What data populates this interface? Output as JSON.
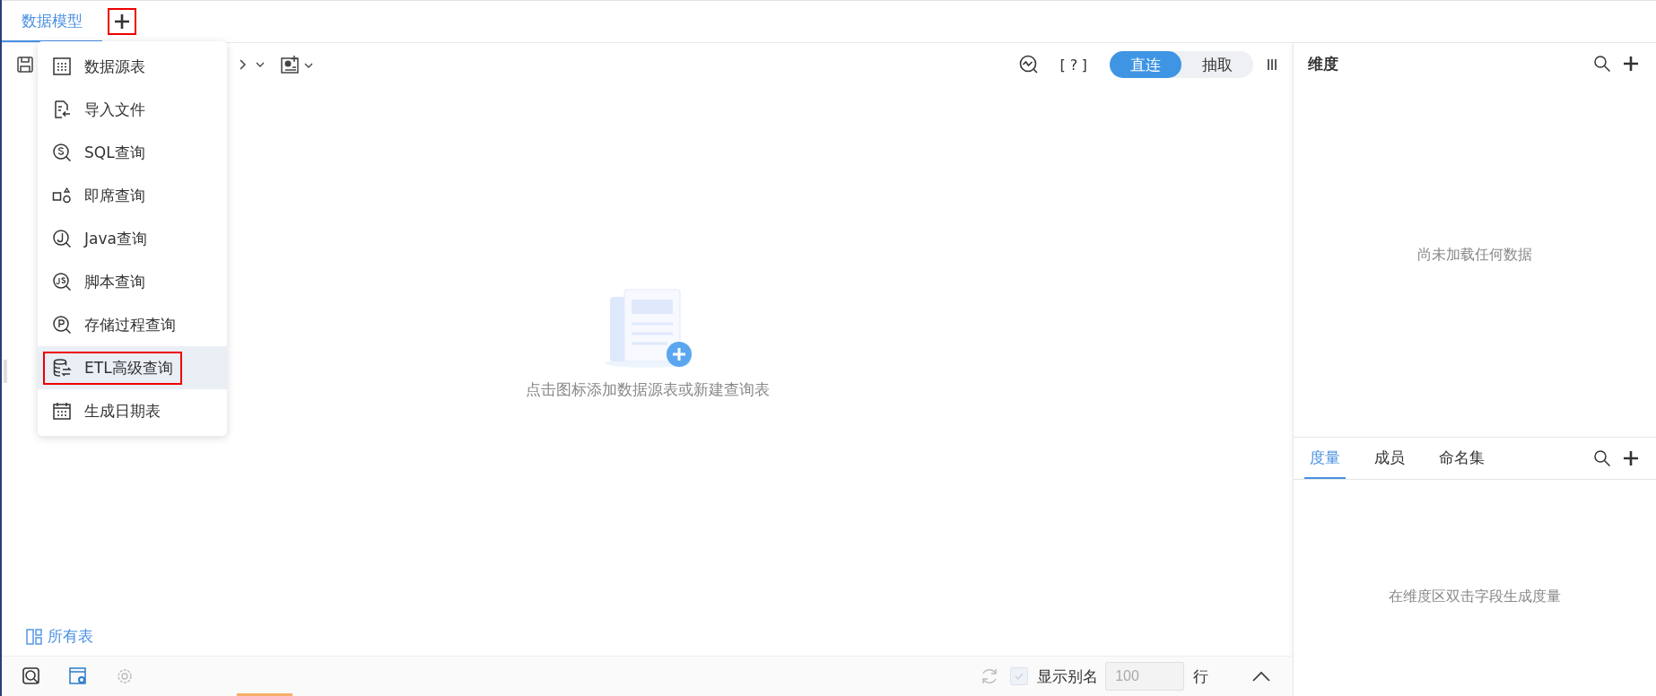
{
  "tabs": [
    {
      "label": "数据模型",
      "selected": true
    }
  ],
  "add_tab": {
    "marked": true
  },
  "toolbar": {
    "help": "[?]",
    "mode_toggle": [
      {
        "label": "直连",
        "selected": true
      },
      {
        "label": "抽取",
        "selected": false
      }
    ]
  },
  "add_menu": {
    "items": [
      {
        "kind": "table",
        "label": "数据源表",
        "selected": false,
        "marked": false
      },
      {
        "kind": "file",
        "label": "导入文件",
        "selected": false,
        "marked": false
      },
      {
        "kind": "sql",
        "label": "SQL查询",
        "selected": false,
        "marked": false
      },
      {
        "kind": "adhoc",
        "label": "即席查询",
        "selected": false,
        "marked": false
      },
      {
        "kind": "java",
        "label": "Java查询",
        "selected": false,
        "marked": false
      },
      {
        "kind": "script",
        "label": "脚本查询",
        "selected": false,
        "marked": false
      },
      {
        "kind": "procedure",
        "label": "存储过程查询",
        "selected": false,
        "marked": false
      },
      {
        "kind": "etl",
        "label": "ETL高级查询",
        "selected": true,
        "marked": true
      },
      {
        "kind": "calendar",
        "label": "生成日期表",
        "selected": false,
        "marked": false
      }
    ]
  },
  "canvas": {
    "empty_message": "点击图标添加数据源表或新建查询表",
    "all_tables_link": "所有表"
  },
  "dimension_panel": {
    "title": "维度",
    "empty_message": "尚未加载任何数据"
  },
  "measure_panel": {
    "tabs": [
      {
        "label": "度量",
        "selected": true
      },
      {
        "label": "成员",
        "selected": false
      },
      {
        "label": "命名集",
        "selected": false
      }
    ],
    "empty_message": "在维度区双击字段生成度量"
  },
  "bottom_bar": {
    "show_alias": {
      "label": "显示别名",
      "checked": true,
      "disabled": true
    },
    "row_count": {
      "placeholder": "100"
    },
    "row_unit": "行"
  }
}
